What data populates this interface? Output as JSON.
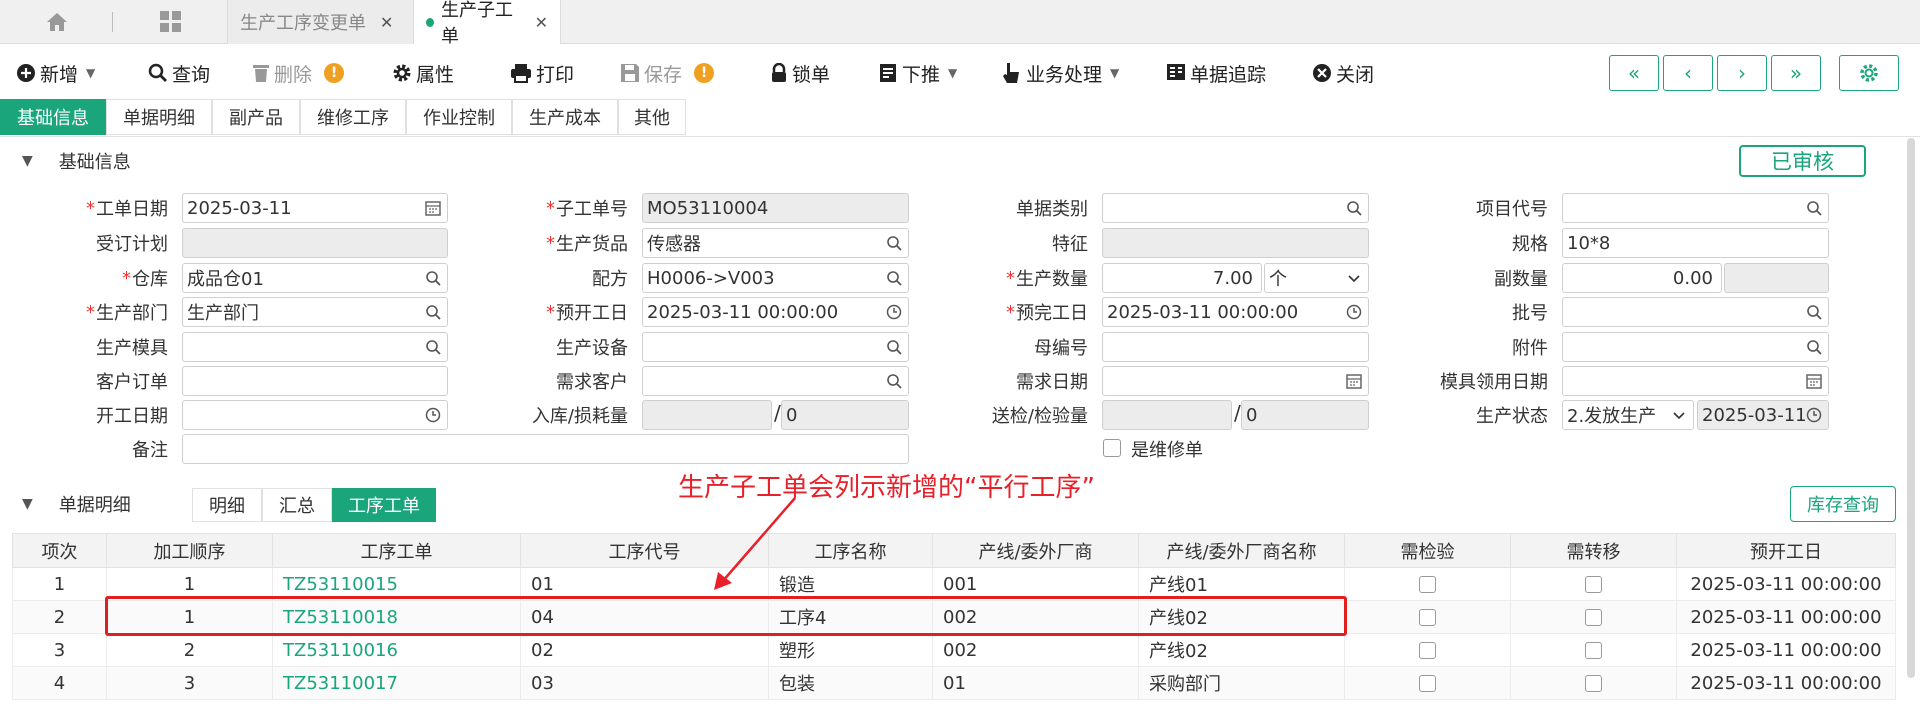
{
  "tabs": {
    "inactive_label": "生产工序变更单",
    "active_label": "生产子工单",
    "close_glyph": "✕"
  },
  "toolbar": {
    "add": "新增",
    "query": "查询",
    "delete": "删除",
    "properties": "属性",
    "print": "打印",
    "save": "保存",
    "lock": "锁单",
    "push": "下推",
    "business": "业务处理",
    "trace": "单据追踪",
    "close": "关闭",
    "warn": "!",
    "nav_first": "«",
    "nav_prev": "‹",
    "nav_next": "›",
    "nav_last": "»"
  },
  "subtabs": [
    "基础信息",
    "单据明细",
    "副产品",
    "维修工序",
    "作业控制",
    "生产成本",
    "其他"
  ],
  "basic": {
    "section_title": "基础信息",
    "status_badge": "已审核",
    "labels": {
      "order_date": "工单日期",
      "order_plan": "受订计划",
      "warehouse": "仓库",
      "dept": "生产部门",
      "mold": "生产模具",
      "customer_order": "客户订单",
      "start_date": "开工日期",
      "remark": "备注",
      "sub_no": "子工单号",
      "product": "生产货品",
      "formula": "配方",
      "plan_start": "预开工日",
      "equipment": "生产设备",
      "demand_customer": "需求客户",
      "in_loss": "入库/损耗量",
      "doc_type": "单据类别",
      "feature": "特征",
      "qty": "生产数量",
      "plan_end": "预完工日",
      "parent_no": "母编号",
      "demand_date": "需求日期",
      "inspect_qty": "送检/检验量",
      "project_code": "项目代号",
      "spec": "规格",
      "sub_qty": "副数量",
      "batch": "批号",
      "attachment": "附件",
      "mold_date": "模具领用日期",
      "prod_status": "生产状态",
      "is_repair": "是维修单"
    },
    "values": {
      "order_date": "2025-03-11",
      "warehouse": "成品仓01",
      "dept": "生产部门",
      "sub_no": "MO53110004",
      "product": "传感器",
      "formula": "H0006->V003",
      "plan_start": "2025-03-11 00:00:00",
      "in_loss_right": "0",
      "qty": "7.00",
      "unit": "个",
      "plan_end": "2025-03-11 00:00:00",
      "inspect_right": "0",
      "spec": "10*8",
      "sub_qty": "0.00",
      "prod_status": "2.发放生产",
      "status_date": "2025-03-11"
    }
  },
  "detail": {
    "section_title": "单据明细",
    "tabs": [
      "明细",
      "汇总",
      "工序工单"
    ],
    "stock_query": "库存查询",
    "columns": [
      "项次",
      "加工顺序",
      "工序工单",
      "工序代号",
      "工序名称",
      "产线/委外厂商",
      "产线/委外厂商名称",
      "需检验",
      "需转移",
      "预开工日"
    ],
    "rows": [
      {
        "idx": "1",
        "seq": "1",
        "order": "TZ53110015",
        "code": "01",
        "name": "锻造",
        "line": "001",
        "line_name": "产线01",
        "date": "2025-03-11 00:00:00"
      },
      {
        "idx": "2",
        "seq": "1",
        "order": "TZ53110018",
        "code": "04",
        "name": "工序4",
        "line": "002",
        "line_name": "产线02",
        "date": "2025-03-11 00:00:00"
      },
      {
        "idx": "3",
        "seq": "2",
        "order": "TZ53110016",
        "code": "02",
        "name": "塑形",
        "line": "002",
        "line_name": "产线02",
        "date": "2025-03-11 00:00:00"
      },
      {
        "idx": "4",
        "seq": "3",
        "order": "TZ53110017",
        "code": "03",
        "name": "包装",
        "line": "01",
        "line_name": "采购部门",
        "date": "2025-03-11 00:00:00"
      }
    ]
  },
  "annotation": {
    "text": "生产子工单会列示新增的“平行工序”",
    "color": "#e8202a"
  },
  "colors": {
    "accent": "#1aa57a",
    "required": "#e33333",
    "warning": "#f0a020"
  }
}
